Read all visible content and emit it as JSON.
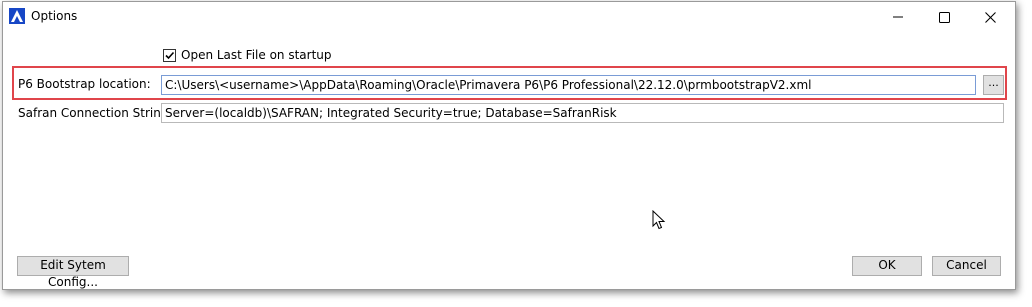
{
  "window": {
    "title": "Options",
    "accent_color": "#1747c6"
  },
  "options": {
    "open_last_file_label": "Open Last File on startup",
    "open_last_file_checked": true
  },
  "p6_bootstrap": {
    "label": "P6 Bootstrap location:",
    "value": "C:\\Users\\<username>\\AppData\\Roaming\\Oracle\\Primavera P6\\P6 Professional\\22.12.0\\prmbootstrapV2.xml",
    "browse_label": "...",
    "highlight_color": "#e0454b"
  },
  "safran": {
    "label": "Safran Connection String:",
    "value": "Server=(localdb)\\SAFRAN; Integrated Security=true; Database=SafranRisk"
  },
  "footer": {
    "edit_config_label": "Edit Sytem Config...",
    "ok_label": "OK",
    "cancel_label": "Cancel"
  },
  "icons": {
    "app": "primavera-app-icon",
    "minimize": "minimize-icon",
    "maximize": "maximize-icon",
    "close": "close-icon",
    "cursor": "mouse-pointer-icon"
  }
}
